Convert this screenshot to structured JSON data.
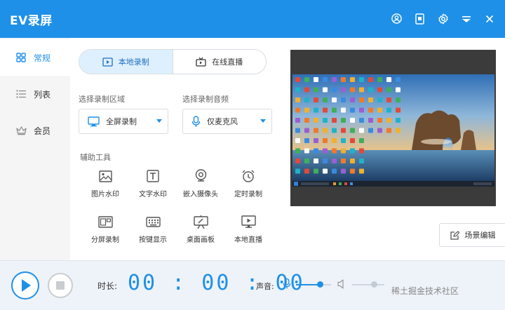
{
  "app": {
    "title": "EV录屏"
  },
  "sidebar": {
    "items": [
      {
        "label": "常规"
      },
      {
        "label": "列表"
      },
      {
        "label": "会员"
      }
    ]
  },
  "mode_tabs": [
    {
      "label": "本地录制"
    },
    {
      "label": "在线直播"
    }
  ],
  "region": {
    "label": "选择录制区域",
    "value": "全屏录制"
  },
  "audio": {
    "label": "选择录制音频",
    "value": "仅麦克风"
  },
  "tools": {
    "label": "辅助工具",
    "items": [
      {
        "label": "图片水印",
        "icon": "image-icon"
      },
      {
        "label": "文字水印",
        "icon": "text-icon"
      },
      {
        "label": "嵌入摄像头",
        "icon": "camera-icon"
      },
      {
        "label": "定时录制",
        "icon": "alarm-icon"
      },
      {
        "label": "分屏录制",
        "icon": "split-screen-icon"
      },
      {
        "label": "按键显示",
        "icon": "keyboard-icon"
      },
      {
        "label": "桌面画板",
        "icon": "whiteboard-icon"
      },
      {
        "label": "本地直播",
        "icon": "monitor-icon"
      }
    ]
  },
  "scene_button": {
    "label": "场景编辑"
  },
  "bottom": {
    "duration_label": "时长:",
    "timer": "00:00:00",
    "volume_label": "声音:",
    "mic_level": 0.68,
    "speaker_level": 0.68
  },
  "watermark": "稀土掘金技术社区",
  "colors": {
    "accent": "#1e90e8",
    "titlebar": "#1e90e8"
  }
}
